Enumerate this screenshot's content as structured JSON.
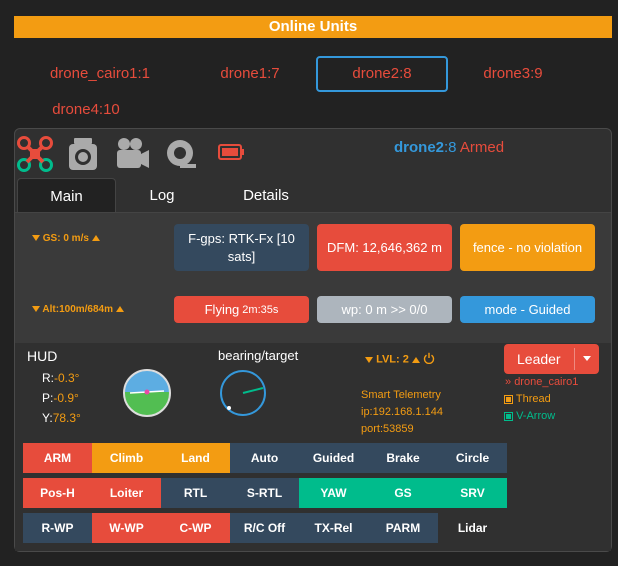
{
  "header": {
    "title": "Online Units"
  },
  "units": [
    {
      "label": "drone_cairo1:1",
      "active": false
    },
    {
      "label": "drone1:7",
      "active": false
    },
    {
      "label": "drone2:8",
      "active": true
    },
    {
      "label": "drone3:9",
      "active": false
    },
    {
      "label": "drone4:10",
      "active": false
    }
  ],
  "unit_title": {
    "name": "drone2",
    "id": ":8",
    "state": "Armed"
  },
  "icons": [
    "drone-icon",
    "camera-icon",
    "video-camera-icon",
    "tape-icon",
    "battery-icon"
  ],
  "tabs": [
    "Main",
    "Log",
    "Details"
  ],
  "steppers": {
    "gs": "GS: 0 m/s",
    "alt": "Alt:100m/684m"
  },
  "indicators": {
    "gps": "F-gps: RTK-Fx [10 sats]",
    "dfm": "DFM: 12,646,362 m",
    "fence": "fence - no violation",
    "flying_prefix": "Flying",
    "flying_time": "2m:35s",
    "wp": "wp: 0 m >> 0/0",
    "mode": "mode - Guided"
  },
  "hud": {
    "title": "HUD",
    "bearing_title": "bearing/target",
    "roll_label": "R:",
    "roll_value": "-0.3°",
    "pitch_label": "P:",
    "pitch_value": "-0.9°",
    "yaw_label": "Y:",
    "yaw_value": "78.3°",
    "lvl": "LVL: 2"
  },
  "telemetry": {
    "title": "Smart Telemetry",
    "ip": "ip:192.168.1.144",
    "port": "port:53859"
  },
  "leader": {
    "button": "Leader",
    "target": "drone_cairo1",
    "thread": "Thread",
    "varrow": "V-Arrow"
  },
  "buttons": {
    "row1": [
      "ARM",
      "Climb",
      "Land",
      "Auto",
      "Guided",
      "Brake",
      "Circle"
    ],
    "row2": [
      "Pos-H",
      "Loiter",
      "RTL",
      "S-RTL",
      "YAW",
      "GS",
      "SRV"
    ],
    "row3": [
      "R-WP",
      "W-WP",
      "C-WP",
      "R/C Off",
      "TX-Rel",
      "PARM",
      "Lidar"
    ]
  },
  "colors": {
    "accent_orange": "#f39c12",
    "danger_red": "#e74c3c",
    "info_blue": "#3498db",
    "success_green": "#00bc8c",
    "dark_blue": "#34495e"
  }
}
